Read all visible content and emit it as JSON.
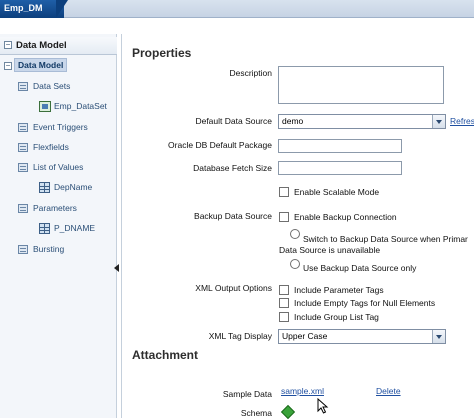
{
  "tab": {
    "title": "Emp_DM"
  },
  "left": {
    "header": "Data Model",
    "tree": [
      {
        "label": "Data Model",
        "level": 0,
        "icon": "minus-toggle"
      },
      {
        "label": "Data Sets",
        "level": 1,
        "icon": "folder-icon"
      },
      {
        "label": "Emp_DataSet",
        "level": 2,
        "icon": "dataset-icon"
      },
      {
        "label": "Event Triggers",
        "level": 1,
        "icon": "folder-icon"
      },
      {
        "label": "Flexfields",
        "level": 1,
        "icon": "folder-icon"
      },
      {
        "label": "List of Values",
        "level": 1,
        "icon": "folder-icon"
      },
      {
        "label": "DepName",
        "level": 2,
        "icon": "grid-icon"
      },
      {
        "label": "Parameters",
        "level": 1,
        "icon": "folder-icon"
      },
      {
        "label": "P_DNAME",
        "level": 2,
        "icon": "grid-icon"
      },
      {
        "label": "Bursting",
        "level": 1,
        "icon": "folder-icon"
      }
    ]
  },
  "properties": {
    "title": "Properties",
    "description_label": "Description",
    "description_value": "",
    "default_ds_label": "Default Data Source",
    "default_ds_value": "demo",
    "refresh_label": "Refres",
    "oracle_pkg_label": "Oracle DB Default Package",
    "oracle_pkg_value": "",
    "fetch_size_label": "Database Fetch Size",
    "fetch_size_value": "",
    "scalable_label": "Enable Scalable Mode",
    "backup_label": "Backup Data Source",
    "enable_backup_label": "Enable Backup Connection",
    "switch_label_1": "Switch to Backup Data Source when Primar",
    "switch_label_2": "Data Source is unavailable",
    "use_backup_label": "Use Backup Data Source only",
    "xml_output_label": "XML Output Options",
    "include_param_label": "Include Parameter Tags",
    "include_empty_label": "Include Empty Tags for Null Elements",
    "include_group_label": "Include Group List Tag",
    "xml_tag_label": "XML Tag Display",
    "xml_tag_value": "Upper Case"
  },
  "attachment": {
    "title": "Attachment",
    "sample_label": "Sample Data",
    "sample_link": "sample.xml",
    "delete_link": "Delete",
    "schema_label": "Schema"
  }
}
